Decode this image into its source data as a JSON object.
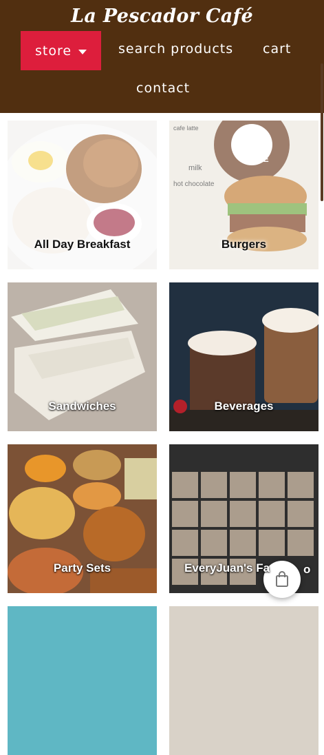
{
  "header": {
    "brand": "La Pescador Café",
    "nav": {
      "store": "store",
      "search": "search products",
      "cart": "cart",
      "contact": "contact"
    }
  },
  "categories": [
    {
      "label": "All Day Breakfast"
    },
    {
      "label": "Burgers"
    },
    {
      "label": "Sandwiches"
    },
    {
      "label": "Beverages"
    },
    {
      "label": "Party Sets"
    },
    {
      "label": "EveryJuan's Fa"
    },
    {
      "label": ""
    },
    {
      "label": ""
    }
  ],
  "tile_signs": {
    "cafe": "CAFE",
    "milk": "milk",
    "hot_chocolate": "hot chocolate",
    "cafe_latte": "cafe latte"
  },
  "overlay": {
    "fab_icon": "shopping-bag-icon",
    "partial_text": "o"
  },
  "colors": {
    "header": "#512f10",
    "accent": "#dd1e3c"
  }
}
